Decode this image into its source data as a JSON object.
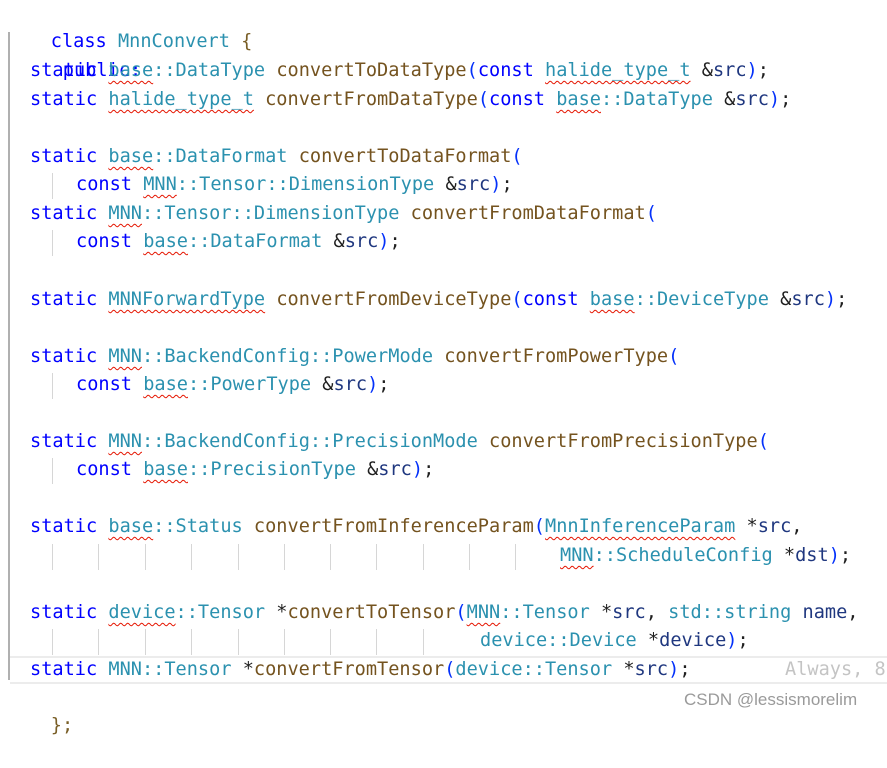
{
  "editor": {
    "class_keyword": "class",
    "class_name": "MnnConvert",
    "open_brace": "{",
    "access_specifier": "public:",
    "close_brace": "};",
    "lines": [
      {
        "id": "convertToDataType",
        "tokens": [
          {
            "t": "static",
            "c": "kw"
          },
          {
            "t": " ",
            "c": "pn"
          },
          {
            "t": "base",
            "c": "ns",
            "err": true
          },
          {
            "t": "::DataType",
            "c": "ty"
          },
          {
            "t": " ",
            "c": "pn"
          },
          {
            "t": "convertToDataType",
            "c": "fn"
          },
          {
            "t": "(",
            "c": "paren"
          },
          {
            "t": "const",
            "c": "kw"
          },
          {
            "t": " ",
            "c": "pn"
          },
          {
            "t": "halide_type_t",
            "c": "ty",
            "err": true
          },
          {
            "t": " &",
            "c": "op"
          },
          {
            "t": "src",
            "c": "param"
          },
          {
            "t": ")",
            "c": "paren"
          },
          {
            "t": ";",
            "c": "pn"
          }
        ]
      },
      {
        "id": "convertFromDataType",
        "tokens": [
          {
            "t": "static",
            "c": "kw"
          },
          {
            "t": " ",
            "c": "pn"
          },
          {
            "t": "halide_type_t",
            "c": "ty",
            "err": true
          },
          {
            "t": " ",
            "c": "pn"
          },
          {
            "t": "convertFromDataType",
            "c": "fn"
          },
          {
            "t": "(",
            "c": "paren"
          },
          {
            "t": "const",
            "c": "kw"
          },
          {
            "t": " ",
            "c": "pn"
          },
          {
            "t": "base",
            "c": "ns",
            "err": true
          },
          {
            "t": "::DataType",
            "c": "ty"
          },
          {
            "t": " &",
            "c": "op"
          },
          {
            "t": "src",
            "c": "param"
          },
          {
            "t": ")",
            "c": "paren"
          },
          {
            "t": ";",
            "c": "pn"
          }
        ]
      },
      {
        "id": "convertToDataFormat",
        "tokens": [
          {
            "t": "static",
            "c": "kw"
          },
          {
            "t": " ",
            "c": "pn"
          },
          {
            "t": "base",
            "c": "ns",
            "err": true
          },
          {
            "t": "::DataFormat",
            "c": "ty"
          },
          {
            "t": " ",
            "c": "pn"
          },
          {
            "t": "convertToDataFormat",
            "c": "fn"
          },
          {
            "t": "(",
            "c": "paren"
          }
        ]
      },
      {
        "id": "convertToDataFormat-cont",
        "tokens": [
          {
            "t": "const",
            "c": "kw"
          },
          {
            "t": " ",
            "c": "pn"
          },
          {
            "t": "MNN",
            "c": "ns",
            "err": true
          },
          {
            "t": "::Tensor::DimensionType",
            "c": "ty"
          },
          {
            "t": " &",
            "c": "op"
          },
          {
            "t": "src",
            "c": "param"
          },
          {
            "t": ")",
            "c": "paren"
          },
          {
            "t": ";",
            "c": "pn"
          }
        ]
      },
      {
        "id": "convertFromDataFormat",
        "tokens": [
          {
            "t": "static",
            "c": "kw"
          },
          {
            "t": " ",
            "c": "pn"
          },
          {
            "t": "MNN",
            "c": "ns",
            "err": true
          },
          {
            "t": "::Tensor::DimensionType",
            "c": "ty"
          },
          {
            "t": " ",
            "c": "pn"
          },
          {
            "t": "convertFromDataFormat",
            "c": "fn"
          },
          {
            "t": "(",
            "c": "paren"
          }
        ]
      },
      {
        "id": "convertFromDataFormat-cont",
        "tokens": [
          {
            "t": "const",
            "c": "kw"
          },
          {
            "t": " ",
            "c": "pn"
          },
          {
            "t": "base",
            "c": "ns",
            "err": true
          },
          {
            "t": "::DataFormat",
            "c": "ty"
          },
          {
            "t": " &",
            "c": "op"
          },
          {
            "t": "src",
            "c": "param"
          },
          {
            "t": ")",
            "c": "paren"
          },
          {
            "t": ";",
            "c": "pn"
          }
        ]
      },
      {
        "id": "convertFromDeviceType",
        "tokens": [
          {
            "t": "static",
            "c": "kw"
          },
          {
            "t": " ",
            "c": "pn"
          },
          {
            "t": "MNNForwardType",
            "c": "ty",
            "err": true
          },
          {
            "t": " ",
            "c": "pn"
          },
          {
            "t": "convertFromDeviceType",
            "c": "fn"
          },
          {
            "t": "(",
            "c": "paren"
          },
          {
            "t": "const",
            "c": "kw"
          },
          {
            "t": " ",
            "c": "pn"
          },
          {
            "t": "base",
            "c": "ns",
            "err": true
          },
          {
            "t": "::DeviceType",
            "c": "ty"
          },
          {
            "t": " &",
            "c": "op"
          },
          {
            "t": "src",
            "c": "param"
          },
          {
            "t": ")",
            "c": "paren"
          },
          {
            "t": ";",
            "c": "pn"
          }
        ]
      },
      {
        "id": "convertFromPowerType",
        "tokens": [
          {
            "t": "static",
            "c": "kw"
          },
          {
            "t": " ",
            "c": "pn"
          },
          {
            "t": "MNN",
            "c": "ns",
            "err": true
          },
          {
            "t": "::BackendConfig::PowerMode",
            "c": "ty"
          },
          {
            "t": " ",
            "c": "pn"
          },
          {
            "t": "convertFromPowerType",
            "c": "fn"
          },
          {
            "t": "(",
            "c": "paren"
          }
        ]
      },
      {
        "id": "convertFromPowerType-cont",
        "tokens": [
          {
            "t": "const",
            "c": "kw"
          },
          {
            "t": " ",
            "c": "pn"
          },
          {
            "t": "base",
            "c": "ns",
            "err": true
          },
          {
            "t": "::PowerType",
            "c": "ty"
          },
          {
            "t": " &",
            "c": "op"
          },
          {
            "t": "src",
            "c": "param"
          },
          {
            "t": ")",
            "c": "paren"
          },
          {
            "t": ";",
            "c": "pn"
          }
        ]
      },
      {
        "id": "convertFromPrecisionType",
        "tokens": [
          {
            "t": "static",
            "c": "kw"
          },
          {
            "t": " ",
            "c": "pn"
          },
          {
            "t": "MNN",
            "c": "ns",
            "err": true
          },
          {
            "t": "::BackendConfig::PrecisionMode",
            "c": "ty"
          },
          {
            "t": " ",
            "c": "pn"
          },
          {
            "t": "convertFromPrecisionType",
            "c": "fn"
          },
          {
            "t": "(",
            "c": "paren"
          }
        ]
      },
      {
        "id": "convertFromPrecisionType-cont",
        "tokens": [
          {
            "t": "const",
            "c": "kw"
          },
          {
            "t": " ",
            "c": "pn"
          },
          {
            "t": "base",
            "c": "ns",
            "err": true
          },
          {
            "t": "::PrecisionType",
            "c": "ty"
          },
          {
            "t": " &",
            "c": "op"
          },
          {
            "t": "src",
            "c": "param"
          },
          {
            "t": ")",
            "c": "paren"
          },
          {
            "t": ";",
            "c": "pn"
          }
        ]
      },
      {
        "id": "convertFromInferenceParam",
        "tokens": [
          {
            "t": "static",
            "c": "kw"
          },
          {
            "t": " ",
            "c": "pn"
          },
          {
            "t": "base",
            "c": "ns",
            "err": true
          },
          {
            "t": "::Status",
            "c": "ty"
          },
          {
            "t": " ",
            "c": "pn"
          },
          {
            "t": "convertFromInferenceParam",
            "c": "fn"
          },
          {
            "t": "(",
            "c": "paren"
          },
          {
            "t": "MnnInferenceParam",
            "c": "ty",
            "err": true
          },
          {
            "t": " *",
            "c": "op"
          },
          {
            "t": "src",
            "c": "param"
          },
          {
            "t": ",",
            "c": "pn"
          }
        ]
      },
      {
        "id": "convertFromInferenceParam-cont",
        "tokens": [
          {
            "t": "MNN",
            "c": "ns",
            "err": true
          },
          {
            "t": "::ScheduleConfig",
            "c": "ty"
          },
          {
            "t": " *",
            "c": "op"
          },
          {
            "t": "dst",
            "c": "param"
          },
          {
            "t": ")",
            "c": "paren"
          },
          {
            "t": ";",
            "c": "pn"
          }
        ]
      },
      {
        "id": "convertToTensor",
        "tokens": [
          {
            "t": "static",
            "c": "kw"
          },
          {
            "t": " ",
            "c": "pn"
          },
          {
            "t": "device",
            "c": "ns",
            "err": true
          },
          {
            "t": "::Tensor",
            "c": "ty"
          },
          {
            "t": " *",
            "c": "op"
          },
          {
            "t": "convertToTensor",
            "c": "fn"
          },
          {
            "t": "(",
            "c": "paren"
          },
          {
            "t": "MNN",
            "c": "ns",
            "err": true
          },
          {
            "t": "::Tensor",
            "c": "ty"
          },
          {
            "t": " *",
            "c": "op"
          },
          {
            "t": "src",
            "c": "param"
          },
          {
            "t": ", ",
            "c": "pn"
          },
          {
            "t": "std::string",
            "c": "ty"
          },
          {
            "t": " ",
            "c": "pn"
          },
          {
            "t": "name",
            "c": "param"
          },
          {
            "t": ",",
            "c": "pn"
          }
        ]
      },
      {
        "id": "convertToTensor-cont",
        "tokens": [
          {
            "t": "device::Device",
            "c": "ty"
          },
          {
            "t": " *",
            "c": "op"
          },
          {
            "t": "device",
            "c": "param"
          },
          {
            "t": ")",
            "c": "paren"
          },
          {
            "t": ";",
            "c": "pn"
          }
        ]
      },
      {
        "id": "convertFromTensor",
        "tokens": [
          {
            "t": "static",
            "c": "kw"
          },
          {
            "t": " ",
            "c": "pn"
          },
          {
            "t": "MNN::Tensor",
            "c": "ty"
          },
          {
            "t": " *",
            "c": "op"
          },
          {
            "t": "convertFromTensor",
            "c": "fn"
          },
          {
            "t": "(",
            "c": "paren"
          },
          {
            "t": "device::Tensor",
            "c": "ty"
          },
          {
            "t": " *",
            "c": "op"
          },
          {
            "t": "src",
            "c": "param"
          },
          {
            "t": ")",
            "c": "paren"
          },
          {
            "t": ";",
            "c": "pn"
          }
        ]
      }
    ],
    "inline_hint": "Always, 8"
  },
  "watermark": "CSDN @lessismorelim"
}
